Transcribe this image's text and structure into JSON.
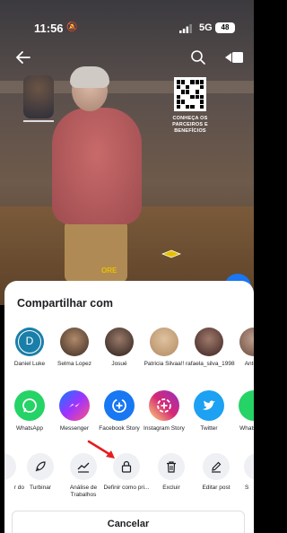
{
  "status_bar": {
    "time": "11:56",
    "network": "5G",
    "battery": "48"
  },
  "video": {
    "qr_caption": "CONHEÇA OS PARCEIROS E BENEFÍCIOS",
    "overlay_text": "ORE"
  },
  "share_sheet": {
    "title": "Compartilhar com",
    "contacts": [
      {
        "name": "Daniel Luke",
        "initial": "D",
        "color": "#1a7fa8"
      },
      {
        "name": "Selma Lopez",
        "color": "#6b4a3a"
      },
      {
        "name": "Josué",
        "color": "#3d2e2a"
      },
      {
        "name": "Patricia Silvaa!!",
        "color": "#c8a27a"
      },
      {
        "name": "rafaela_silva_1998",
        "color": "#5a3a3a"
      },
      {
        "name": "Antoi A",
        "color": "#8a6a5a"
      }
    ],
    "apps": [
      {
        "name": "WhatsApp",
        "icon": "whatsapp-icon",
        "color": "#25d366"
      },
      {
        "name": "Messenger",
        "icon": "messenger-icon",
        "color": "#a033ff"
      },
      {
        "name": "Facebook Story",
        "icon": "facebook-story-icon",
        "color": "#1877f2"
      },
      {
        "name": "Instagram Story",
        "icon": "instagram-icon",
        "color": "#e1306c"
      },
      {
        "name": "Twitter",
        "icon": "twitter-icon",
        "color": "#1da1f2"
      },
      {
        "name": "Whats Stat",
        "icon": "whatsapp-status-icon",
        "color": "#25d366"
      }
    ],
    "actions": [
      {
        "name": "r do",
        "icon": "partial-icon"
      },
      {
        "name": "Turbinar",
        "icon": "rocket-icon"
      },
      {
        "name": "Análise de Trabalhos",
        "icon": "chart-icon"
      },
      {
        "name": "Definir como pri...",
        "icon": "lock-icon"
      },
      {
        "name": "Excluir",
        "icon": "trash-icon"
      },
      {
        "name": "Editar post",
        "icon": "pencil-icon"
      },
      {
        "name": "S",
        "icon": "partial-icon"
      }
    ],
    "cancel_label": "Cancelar"
  },
  "colors": {
    "accent": "#1877f2",
    "arrow": "#e41e1e"
  }
}
